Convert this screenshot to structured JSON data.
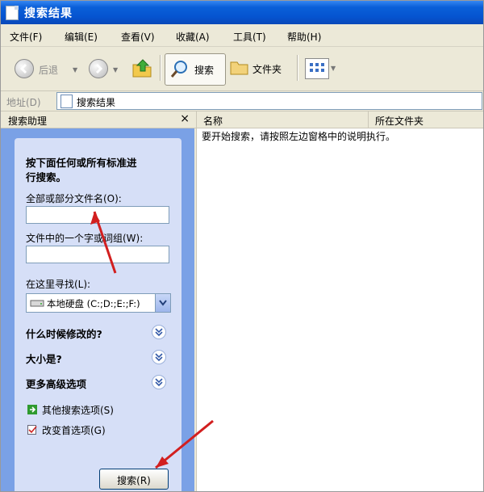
{
  "window": {
    "title": "搜索结果"
  },
  "menu": [
    "文件(F)",
    "编辑(E)",
    "查看(V)",
    "收藏(A)",
    "工具(T)",
    "帮助(H)"
  ],
  "toolbar": {
    "back": "后退",
    "search": "搜索",
    "folders": "文件夹"
  },
  "address": {
    "label": "地址(D)",
    "value": "搜索结果"
  },
  "pane": {
    "title": "搜索助理",
    "close": "×",
    "heading_line1": "按下面任何或所有标准进",
    "heading_line2": "行搜索。",
    "filename_label": "全部或部分文件名(O):",
    "filename_value": "",
    "phrase_label": "文件中的一个字或词组(W):",
    "phrase_value": "",
    "lookin_label": "在这里寻找(L):",
    "lookin_value": "本地硬盘 (C:;D:;E:;F:)",
    "when_modified": "什么时候修改的?",
    "size": "大小是?",
    "advanced": "更多高级选项",
    "other_options": "其他搜索选项(S)",
    "change_prefs": "改变首选项(G)",
    "search_button": "搜索(R)"
  },
  "results": {
    "col_name": "名称",
    "col_folder": "所在文件夹",
    "message": "要开始搜索，请按照左边窗格中的说明执行。"
  },
  "colors": {
    "title_bar": "#0a5fd8",
    "pane_bg": "#7aa1e6",
    "panel_bg": "#d6dff7",
    "arrow": "#d21f1f"
  }
}
